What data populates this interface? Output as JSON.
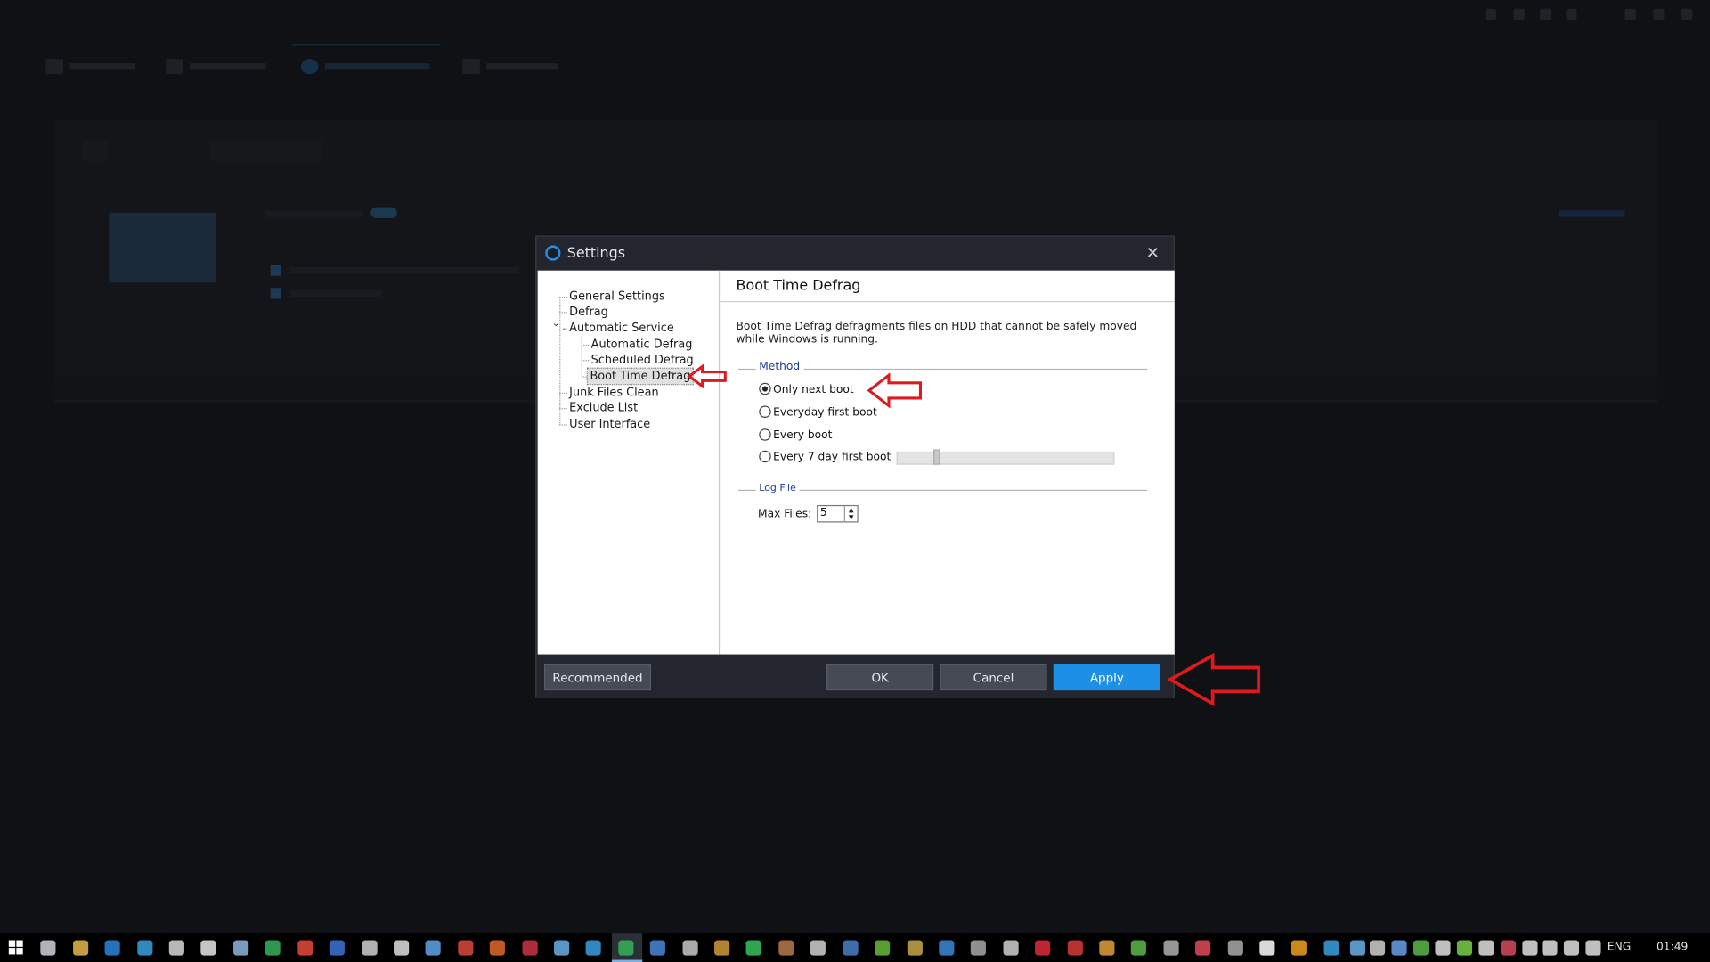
{
  "dialog": {
    "title": "Settings",
    "close_glyph": "✕",
    "icon": "app-logo-icon"
  },
  "tree": {
    "general_settings": "General Settings",
    "defrag": "Defrag",
    "automatic_service": "Automatic Service",
    "expander_glyph": "⌄",
    "automatic_defrag": "Automatic Defrag",
    "scheduled_defrag": "Scheduled Defrag",
    "boot_time_defrag": "Boot Time Defrag",
    "junk_files_clean": "Junk Files Clean",
    "exclude_list": "Exclude List",
    "user_interface": "User Interface",
    "selected": "Boot Time Defrag"
  },
  "content": {
    "header": "Boot Time Defrag",
    "description": "Boot Time Defrag defragments files on HDD that cannot be safely moved while Windows is running.",
    "method_label": "Method",
    "options": [
      {
        "label": "Only next boot",
        "checked": true
      },
      {
        "label": "Everyday first boot",
        "checked": false
      },
      {
        "label": "Every boot",
        "checked": false
      },
      {
        "label": "Every 7 day first boot",
        "checked": false
      }
    ],
    "slider_level": 0.17,
    "log_file_label": "Log File",
    "max_files_label": "Max Files:",
    "max_files_value": "5"
  },
  "footer": {
    "recommended": "Recommended",
    "ok": "OK",
    "cancel": "Cancel",
    "apply": "Apply"
  },
  "colors": {
    "accent": "#1d8fe6",
    "annotation": "#e0191e",
    "group_label": "#1f3c96"
  },
  "taskbar": {
    "language": "ENG",
    "clock": "01:49"
  }
}
